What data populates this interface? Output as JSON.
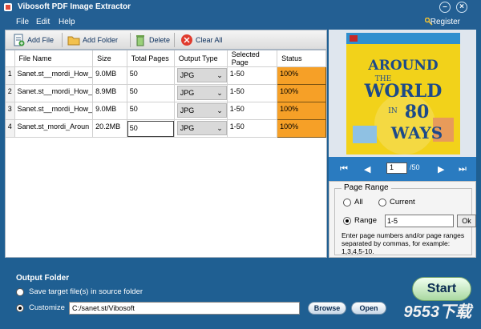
{
  "app": {
    "title": "Vibosoft PDF Image Extractor",
    "register_label": "Register"
  },
  "menu": [
    "File",
    "Edit",
    "Help"
  ],
  "toolbar": {
    "add_file": "Add File",
    "add_folder": "Add Folder",
    "delete": "Delete",
    "clear_all": "Clear All"
  },
  "table": {
    "columns": [
      "File Name",
      "Size",
      "Total Pages",
      "Output Type",
      "Selected Page",
      "Status"
    ],
    "rows": [
      {
        "num": "1",
        "name": "Sanet.st__mordi_How_",
        "size": "9.0MB",
        "pages": "50",
        "type": "JPG",
        "selected": "1-50",
        "status": "100%"
      },
      {
        "num": "2",
        "name": "Sanet.st__mordi_How_",
        "size": "8.9MB",
        "pages": "50",
        "type": "JPG",
        "selected": "1-50",
        "status": "100%"
      },
      {
        "num": "3",
        "name": "Sanet.st__mordi_How_",
        "size": "9.0MB",
        "pages": "50",
        "type": "JPG",
        "selected": "1-50",
        "status": "100%"
      },
      {
        "num": "4",
        "name": "Sanet.st_mordi_Aroun",
        "size": "20.2MB",
        "pages": "50",
        "type": "JPG",
        "selected": "1-50",
        "status": "100%"
      }
    ]
  },
  "preview": {
    "cover_line1": "AROUND",
    "cover_line2": "THE",
    "cover_line3": "WORLD",
    "cover_line4": "IN",
    "cover_line5": "80",
    "cover_line6": "WAYS"
  },
  "nav": {
    "page": "1",
    "total": "/50"
  },
  "page_range": {
    "legend": "Page Range",
    "all": "All",
    "current": "Current",
    "range": "Range",
    "range_value": "1-5",
    "ok": "Ok",
    "hint": "Enter page numbers and/or page ranges separated by commas, for example: 1,3,4,5-10."
  },
  "output": {
    "title": "Output Folder",
    "option_source": "Save target file(s) in source folder",
    "option_custom": "Customize",
    "path": "C:/sanet.st/Vibosoft",
    "browse": "Browse",
    "open": "Open",
    "start": "Start"
  },
  "watermark": "9553下载",
  "colors": {
    "status": "#f6a027",
    "frame": "#1f5f92",
    "nav": "#2a7bc0",
    "cover": "#f2d21a"
  }
}
